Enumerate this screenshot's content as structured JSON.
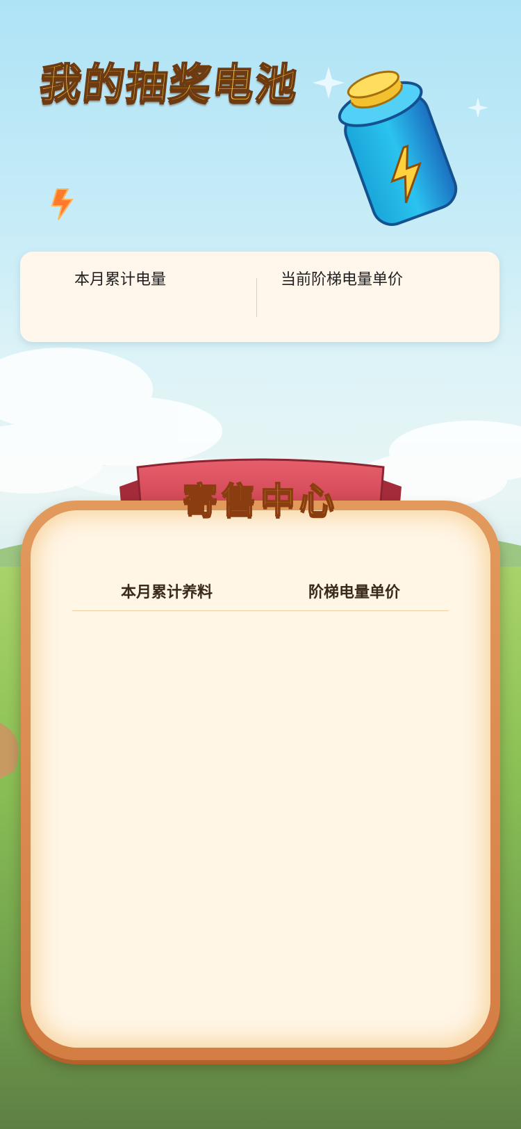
{
  "header": {
    "title": "我的抽奖电池"
  },
  "stats_card": {
    "left_label": "本月累计电量",
    "right_label": "当前阶梯电量单价"
  },
  "consignment": {
    "title": "寄售中心",
    "columns": [
      "本月累计养料",
      "阶梯电量单价"
    ]
  },
  "colors": {
    "title_yellow": "#ffd33f",
    "ribbon_red": "#d5445a",
    "panel_orange": "#d98248",
    "panel_cream": "#fff6e6"
  }
}
